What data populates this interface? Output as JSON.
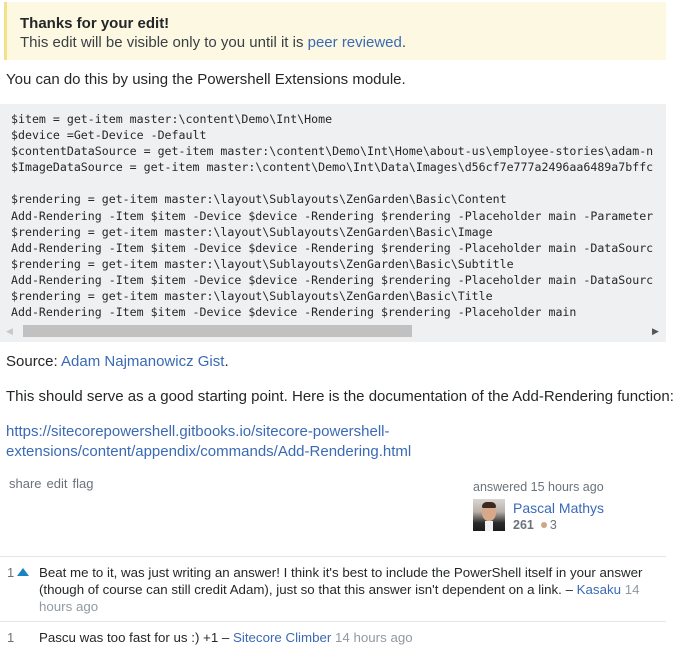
{
  "notice": {
    "title": "Thanks for your edit!",
    "text_before": "This edit will be visible only to you until it is ",
    "link": "peer reviewed",
    "text_after": "."
  },
  "answer": {
    "intro": "You can do this by using the Powershell Extensions module.",
    "code_lines": [
      "$item = get-item master:\\content\\Demo\\Int\\Home",
      "$device =Get-Device -Default",
      "$contentDataSource = get-item master:\\content\\Demo\\Int\\Home\\about-us\\employee-stories\\adam-n",
      "$ImageDataSource = get-item master:\\content\\Demo\\Int\\Data\\Images\\d56cf7e777a2496aa6489a7bffc",
      "",
      "$rendering = get-item master:\\layout\\Sublayouts\\ZenGarden\\Basic\\Content",
      "Add-Rendering -Item $item -Device $device -Rendering $rendering -Placeholder main -Parameter",
      "$rendering = get-item master:\\layout\\Sublayouts\\ZenGarden\\Basic\\Image",
      "Add-Rendering -Item $item -Device $device -Rendering $rendering -Placeholder main -DataSourc",
      "$rendering = get-item master:\\layout\\Sublayouts\\ZenGarden\\Basic\\Subtitle",
      "Add-Rendering -Item $item -Device $device -Rendering $rendering -Placeholder main -DataSourc",
      "$rendering = get-item master:\\layout\\Sublayouts\\ZenGarden\\Basic\\Title",
      "Add-Rendering -Item $item -Device $device -Rendering $rendering -Placeholder main"
    ],
    "code_scroll_fraction": 0.62,
    "source_label": "Source: ",
    "source_link": "Adam Najmanowicz Gist",
    "source_after": ".",
    "doc_text": "This should serve as a good starting point. Here is the documentation of the Add-Rendering function:",
    "doc_link_line1": "https://sitecorepowershell.gitbooks.io/sitecore-powershell-",
    "doc_link_line2": "extensions/content/appendix/commands/Add-Rendering.html"
  },
  "post_menu": {
    "share": "share",
    "edit": "edit",
    "flag": "flag"
  },
  "user_card": {
    "action": "answered 15 hours ago",
    "name": "Pascal Mathys",
    "reputation": "261",
    "bronze_badges": "3"
  },
  "comments": [
    {
      "score": "1",
      "upvoted": true,
      "text": "Beat me to it, was just writing an answer! I think it's best to include the PowerShell itself in your answer (though of course can still credit Adam), just so that this answer isn't dependent on a link. – ",
      "user": "Kasaku",
      "date": "14 hours ago"
    },
    {
      "score": "1",
      "upvoted": false,
      "text": "Pascu was too fast for us :) +1 – ",
      "user": "Sitecore Climber",
      "date": "14 hours ago"
    }
  ]
}
